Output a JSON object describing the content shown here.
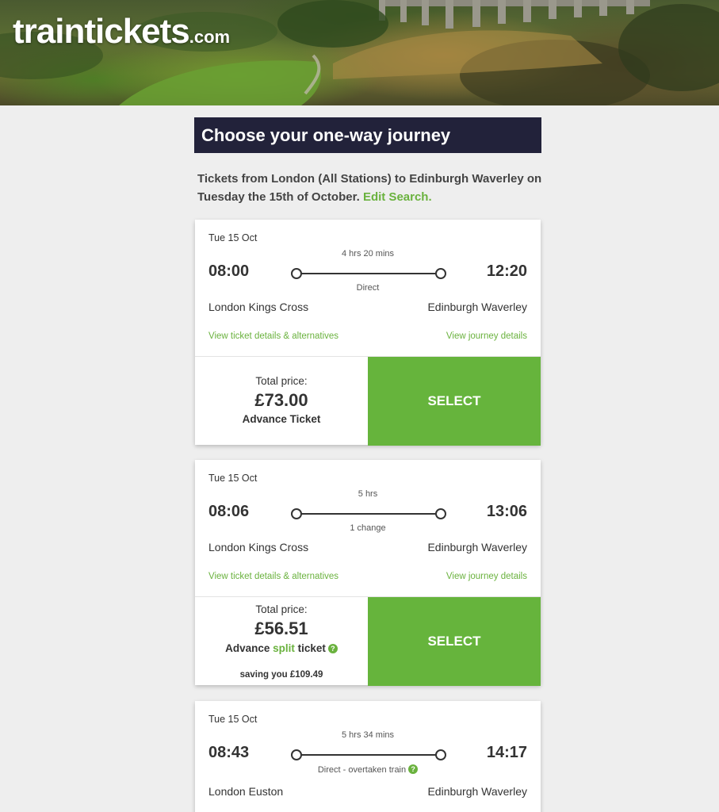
{
  "header": {
    "logo_main": "traintickets",
    "logo_tld": ".com"
  },
  "page_title": "Choose your one-way journey",
  "intro": {
    "text": "Tickets from London (All Stations) to Edinburgh Waverley on Tuesday the 15th of October.",
    "edit_link": "Edit Search."
  },
  "journeys": [
    {
      "date": "Tue 15 Oct",
      "duration": "4 hrs 20 mins",
      "depart": "08:00",
      "arrive": "12:20",
      "changes": "Direct",
      "from": "London Kings Cross",
      "to": "Edinburgh Waverley",
      "ticket_link": "View ticket details & alternatives",
      "journey_link": "View journey details",
      "price_label": "Total price:",
      "price": "£73.00",
      "ticket_type": "Advance Ticket",
      "select_label": "SELECT"
    },
    {
      "date": "Tue 15 Oct",
      "duration": "5 hrs",
      "depart": "08:06",
      "arrive": "13:06",
      "changes": "1 change",
      "from": "London Kings Cross",
      "to": "Edinburgh Waverley",
      "ticket_link": "View ticket details & alternatives",
      "journey_link": "View journey details",
      "price_label": "Total price:",
      "price": "£56.51",
      "ticket_type_pre": "Advance ",
      "ticket_type_highlight": "split",
      "ticket_type_post": " ticket",
      "saving": "saving you £109.49",
      "select_label": "SELECT"
    },
    {
      "date": "Tue 15 Oct",
      "duration": "5 hrs 34 mins",
      "depart": "08:43",
      "arrive": "14:17",
      "changes": "Direct - overtaken train",
      "from": "London Euston",
      "to": "Edinburgh Waverley"
    }
  ],
  "colors": {
    "accent_green": "#66b43c",
    "title_bar": "#22223a",
    "page_background": "#eeeeee"
  },
  "icons": {
    "help": "question-circle-icon"
  },
  "help_glyph": "?"
}
